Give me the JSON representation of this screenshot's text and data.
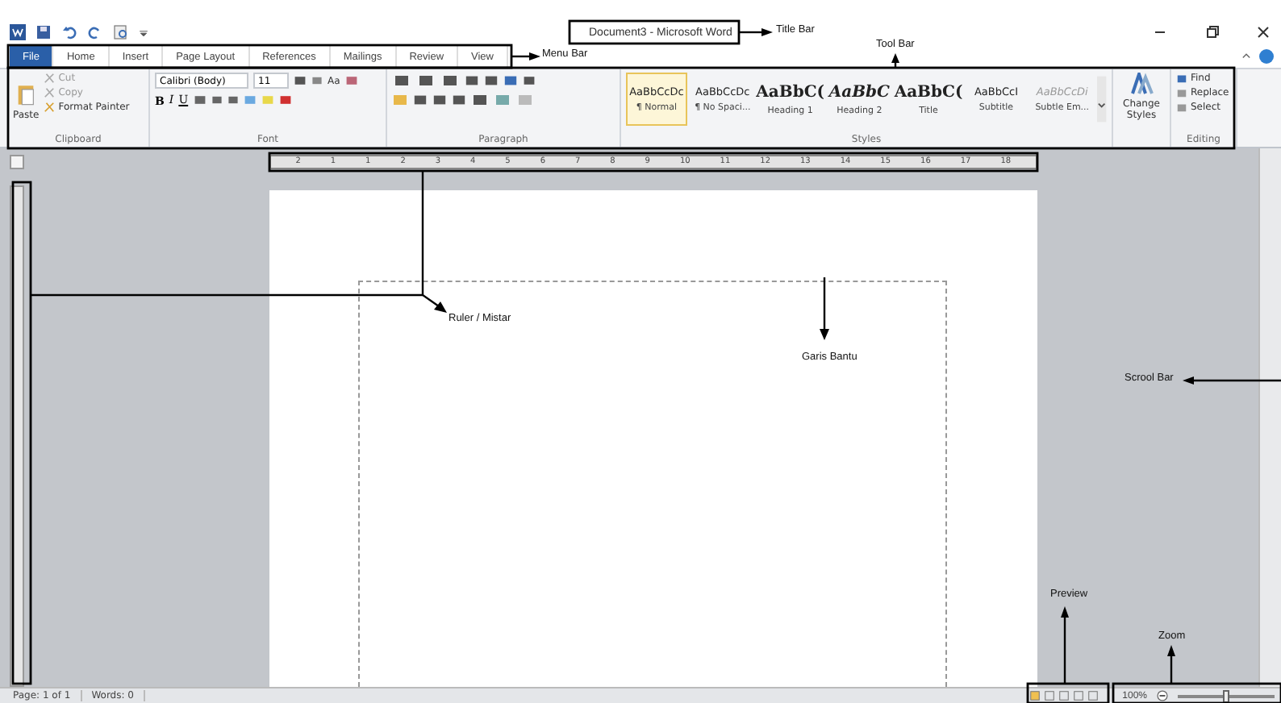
{
  "title_bar": {
    "title": "Document3 - Microsoft Word"
  },
  "menu_tabs": [
    {
      "label": "File",
      "selected": true
    },
    {
      "label": "Home",
      "selected": false
    },
    {
      "label": "Insert",
      "selected": false
    },
    {
      "label": "Page Layout",
      "selected": false
    },
    {
      "label": "References",
      "selected": false
    },
    {
      "label": "Mailings",
      "selected": false
    },
    {
      "label": "Review",
      "selected": false
    },
    {
      "label": "View",
      "selected": false
    }
  ],
  "clipboard": {
    "paste": "Paste",
    "items": [
      "Cut",
      "Copy",
      "Format Painter"
    ],
    "label": "Clipboard"
  },
  "font": {
    "name": "Calibri (Body)",
    "size": "11",
    "change_case": "Aa",
    "glyphs": [
      "B",
      "I",
      "U"
    ],
    "label": "Font"
  },
  "paragraph": {
    "label": "Paragraph"
  },
  "styles": {
    "label": "Styles",
    "items": [
      {
        "preview": "AaBbCcDc",
        "name": "¶ Normal",
        "kind": "plain",
        "selected": true
      },
      {
        "preview": "AaBbCcDc",
        "name": "¶ No Spaci...",
        "kind": "plain",
        "selected": false
      },
      {
        "preview": "AaBbC(",
        "name": "Heading 1",
        "kind": "heading",
        "selected": false
      },
      {
        "preview": "AaBbC",
        "name": "Heading 2",
        "kind": "heading_italic",
        "selected": false
      },
      {
        "preview": "AaBbC(",
        "name": "Title",
        "kind": "heading",
        "selected": false
      },
      {
        "preview": "AaBbCcI",
        "name": "Subtitle",
        "kind": "plain",
        "selected": false
      },
      {
        "preview": "AaBbCcDi",
        "name": "Subtle Em...",
        "kind": "faint",
        "selected": false
      }
    ]
  },
  "change_styles": "Change Styles",
  "editing": {
    "items": [
      "Find",
      "Replace",
      "Select"
    ],
    "label": "Editing"
  },
  "ruler": {
    "numbers": [
      "2",
      "1",
      "1",
      "2",
      "3",
      "4",
      "5",
      "6",
      "7",
      "8",
      "9",
      "10",
      "11",
      "12",
      "13",
      "14",
      "15",
      "16",
      "17",
      "18"
    ]
  },
  "status_bar": {
    "page": "Page: 1 of 1",
    "words": "Words: 0",
    "zoom": "100%",
    "zoom_level": {
      "level": 0.5
    }
  },
  "annotations": [
    {
      "kind": "title_bar",
      "label": "Title Bar"
    },
    {
      "kind": "menu_bar",
      "label": "Menu Bar"
    },
    {
      "kind": "tool_bar",
      "label": "Tool Bar"
    },
    {
      "kind": "ruler",
      "label": "Ruler / Mistar"
    },
    {
      "kind": "guide",
      "label": "Garis Bantu"
    },
    {
      "kind": "scroll_bar",
      "label": "Scrool Bar"
    },
    {
      "kind": "preview",
      "label": "Preview"
    },
    {
      "kind": "zoom",
      "label": "Zoom"
    }
  ]
}
